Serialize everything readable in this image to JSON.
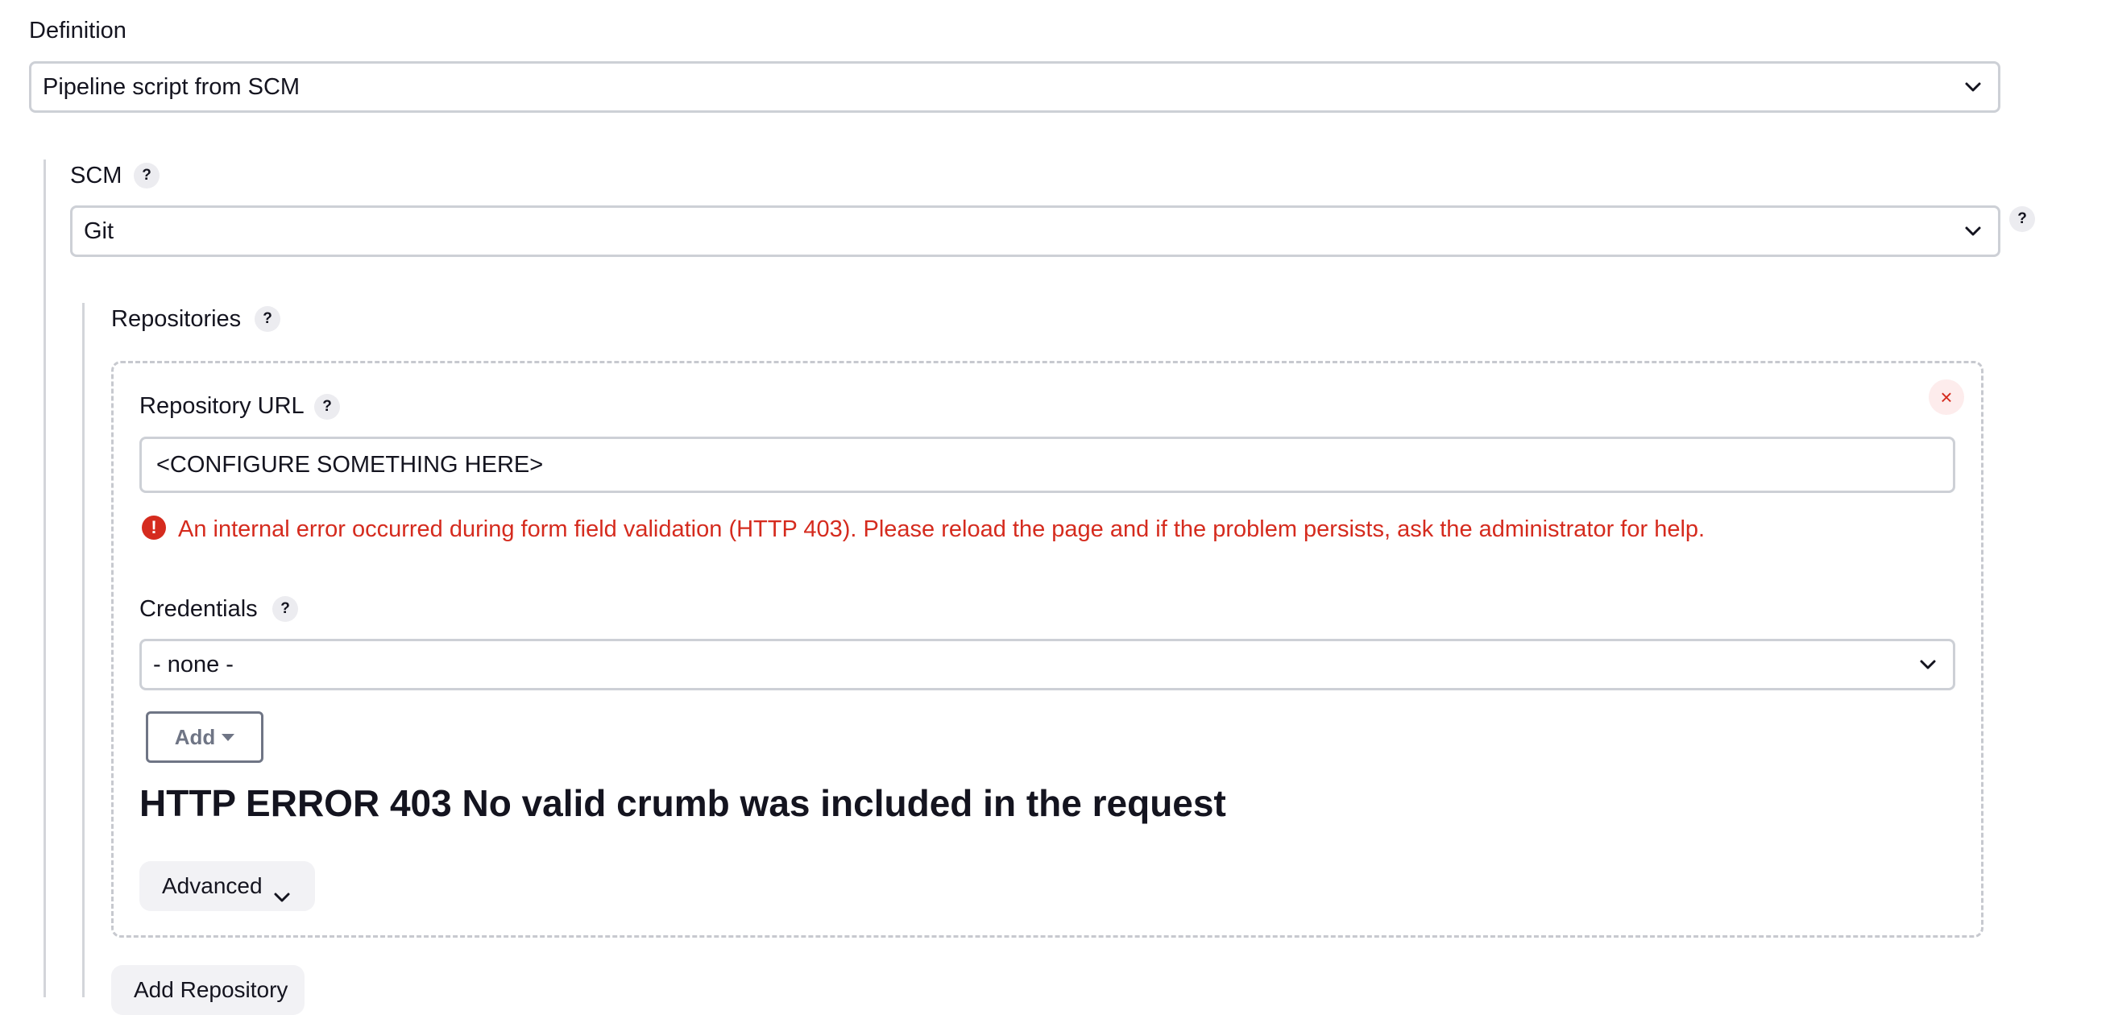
{
  "definition": {
    "label": "Definition",
    "selected": "Pipeline script from SCM"
  },
  "scm": {
    "label": "SCM",
    "help": "?",
    "selected": "Git",
    "side_help": "?"
  },
  "repositories": {
    "label": "Repositories",
    "help": "?",
    "close": "×",
    "repo_url": {
      "label": "Repository URL",
      "help": "?",
      "value": "<CONFIGURE SOMETHING HERE>"
    },
    "error": {
      "icon": "!",
      "message": "An internal error occurred during form field validation (HTTP 403). Please reload the page and if the problem persists, ask the administrator for help."
    },
    "credentials": {
      "label": "Credentials",
      "help": "?",
      "selected": "- none -",
      "add_label": "Add"
    },
    "http_error": "HTTP ERROR 403 No valid crumb was included in the request",
    "advanced_label": "Advanced",
    "add_repository_label": "Add Repository"
  },
  "colors": {
    "error": "#d52b1e",
    "border": "#cdd0d6",
    "text": "#14141f"
  },
  "icons": [
    "chevron-down-icon",
    "help-icon",
    "close-icon",
    "error-icon",
    "caret-down-icon"
  ]
}
